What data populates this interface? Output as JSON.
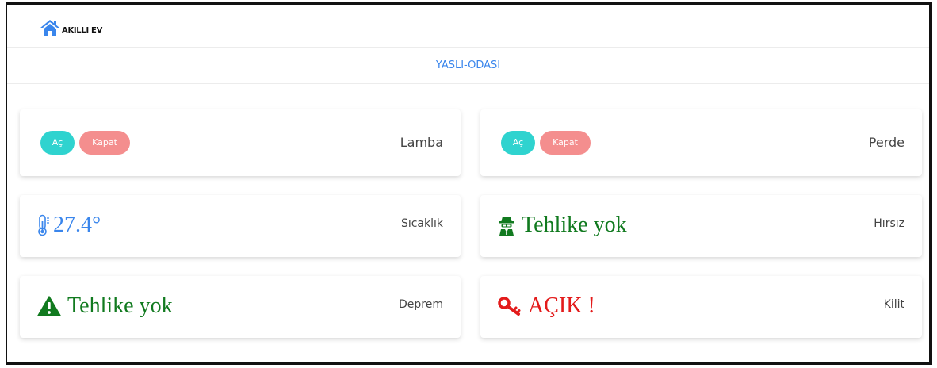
{
  "app": {
    "brand": "AKILLI EV",
    "room": "YASLI-ODASI"
  },
  "colors": {
    "accent_blue": "#3a86ec",
    "open_button": "#2fd3cf",
    "close_button": "#f48e8e",
    "safe_green": "#117a1f",
    "alert_red": "#e31b1b"
  },
  "lamba": {
    "open_label": "Aç",
    "close_label": "Kapat",
    "label": "Lamba"
  },
  "perde": {
    "open_label": "Aç",
    "close_label": "Kapat",
    "label": "Perde"
  },
  "sicaklik": {
    "icon": "thermometer-icon",
    "value": "27.4°",
    "label": "Sıcaklık"
  },
  "hirsiz": {
    "icon": "spy-icon",
    "value": "Tehlike yok",
    "label": "Hırsız"
  },
  "deprem": {
    "icon": "warning-icon",
    "value": "Tehlike yok",
    "label": "Deprem"
  },
  "kilit": {
    "icon": "key-icon",
    "value": "AÇIK !",
    "label": "Kilit"
  }
}
